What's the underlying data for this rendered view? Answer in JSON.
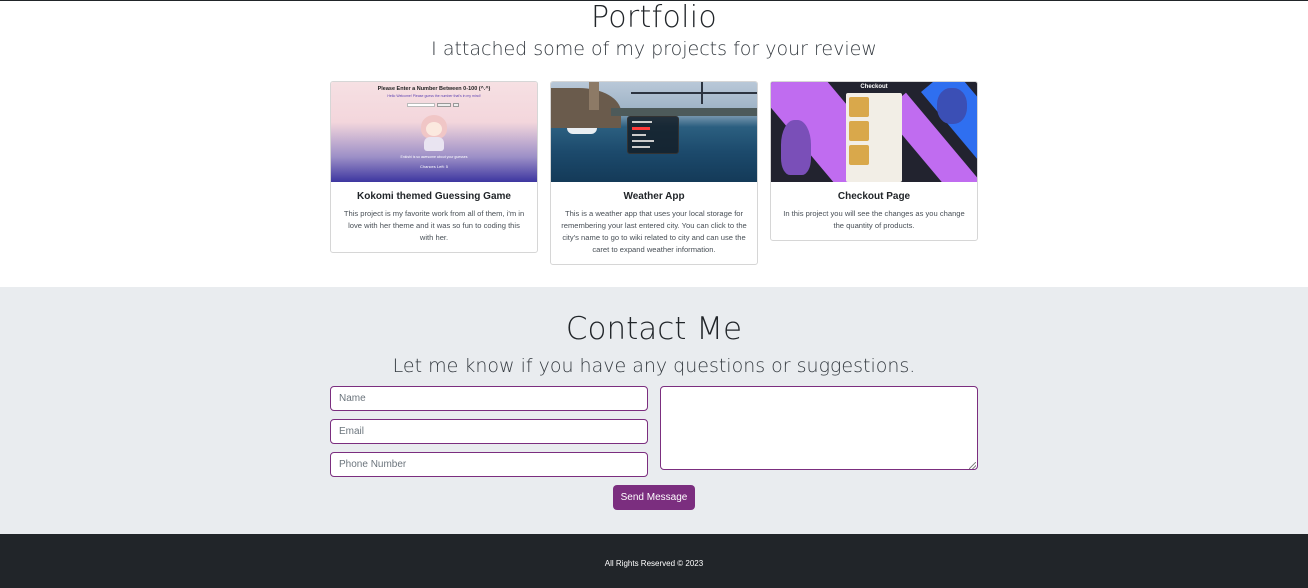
{
  "portfolio": {
    "title": "Portfolio",
    "subtitle": "I attached some of my projects for your review",
    "cards": [
      {
        "title": "Kokomi themed Guessing Game",
        "text": "This project is my favorite work from all of them, i'm in love with her theme and it was so fun to coding this with her.",
        "image": {
          "heading": "Please Enter a Number Between 0-100 (^.^)",
          "subheading": "Hello Welcome! Please guess the number that's in my mind!",
          "footer": "Enkishi is so awesome about your guesses",
          "footer2": "Chances Left: 5"
        }
      },
      {
        "title": "Weather App",
        "text": "This is a weather app that uses your local storage for remembering your last entered city. You can click to the city's name to go to wiki related to city and can use the caret to expand weather information."
      },
      {
        "title": "Checkout Page",
        "text": "In this project you will see the changes as you change the quantity of products.",
        "image": {
          "heading": "Checkout"
        }
      }
    ]
  },
  "contact": {
    "title": "Contact Me",
    "subtitle": "Let me know if you have any questions or suggestions.",
    "name_placeholder": "Name",
    "email_placeholder": "Email",
    "phone_placeholder": "Phone Number",
    "message_placeholder": "",
    "send_label": "Send Message",
    "accent_color": "#7b2e7f"
  },
  "footer": {
    "text": "All Rights Reserved © 2023"
  }
}
